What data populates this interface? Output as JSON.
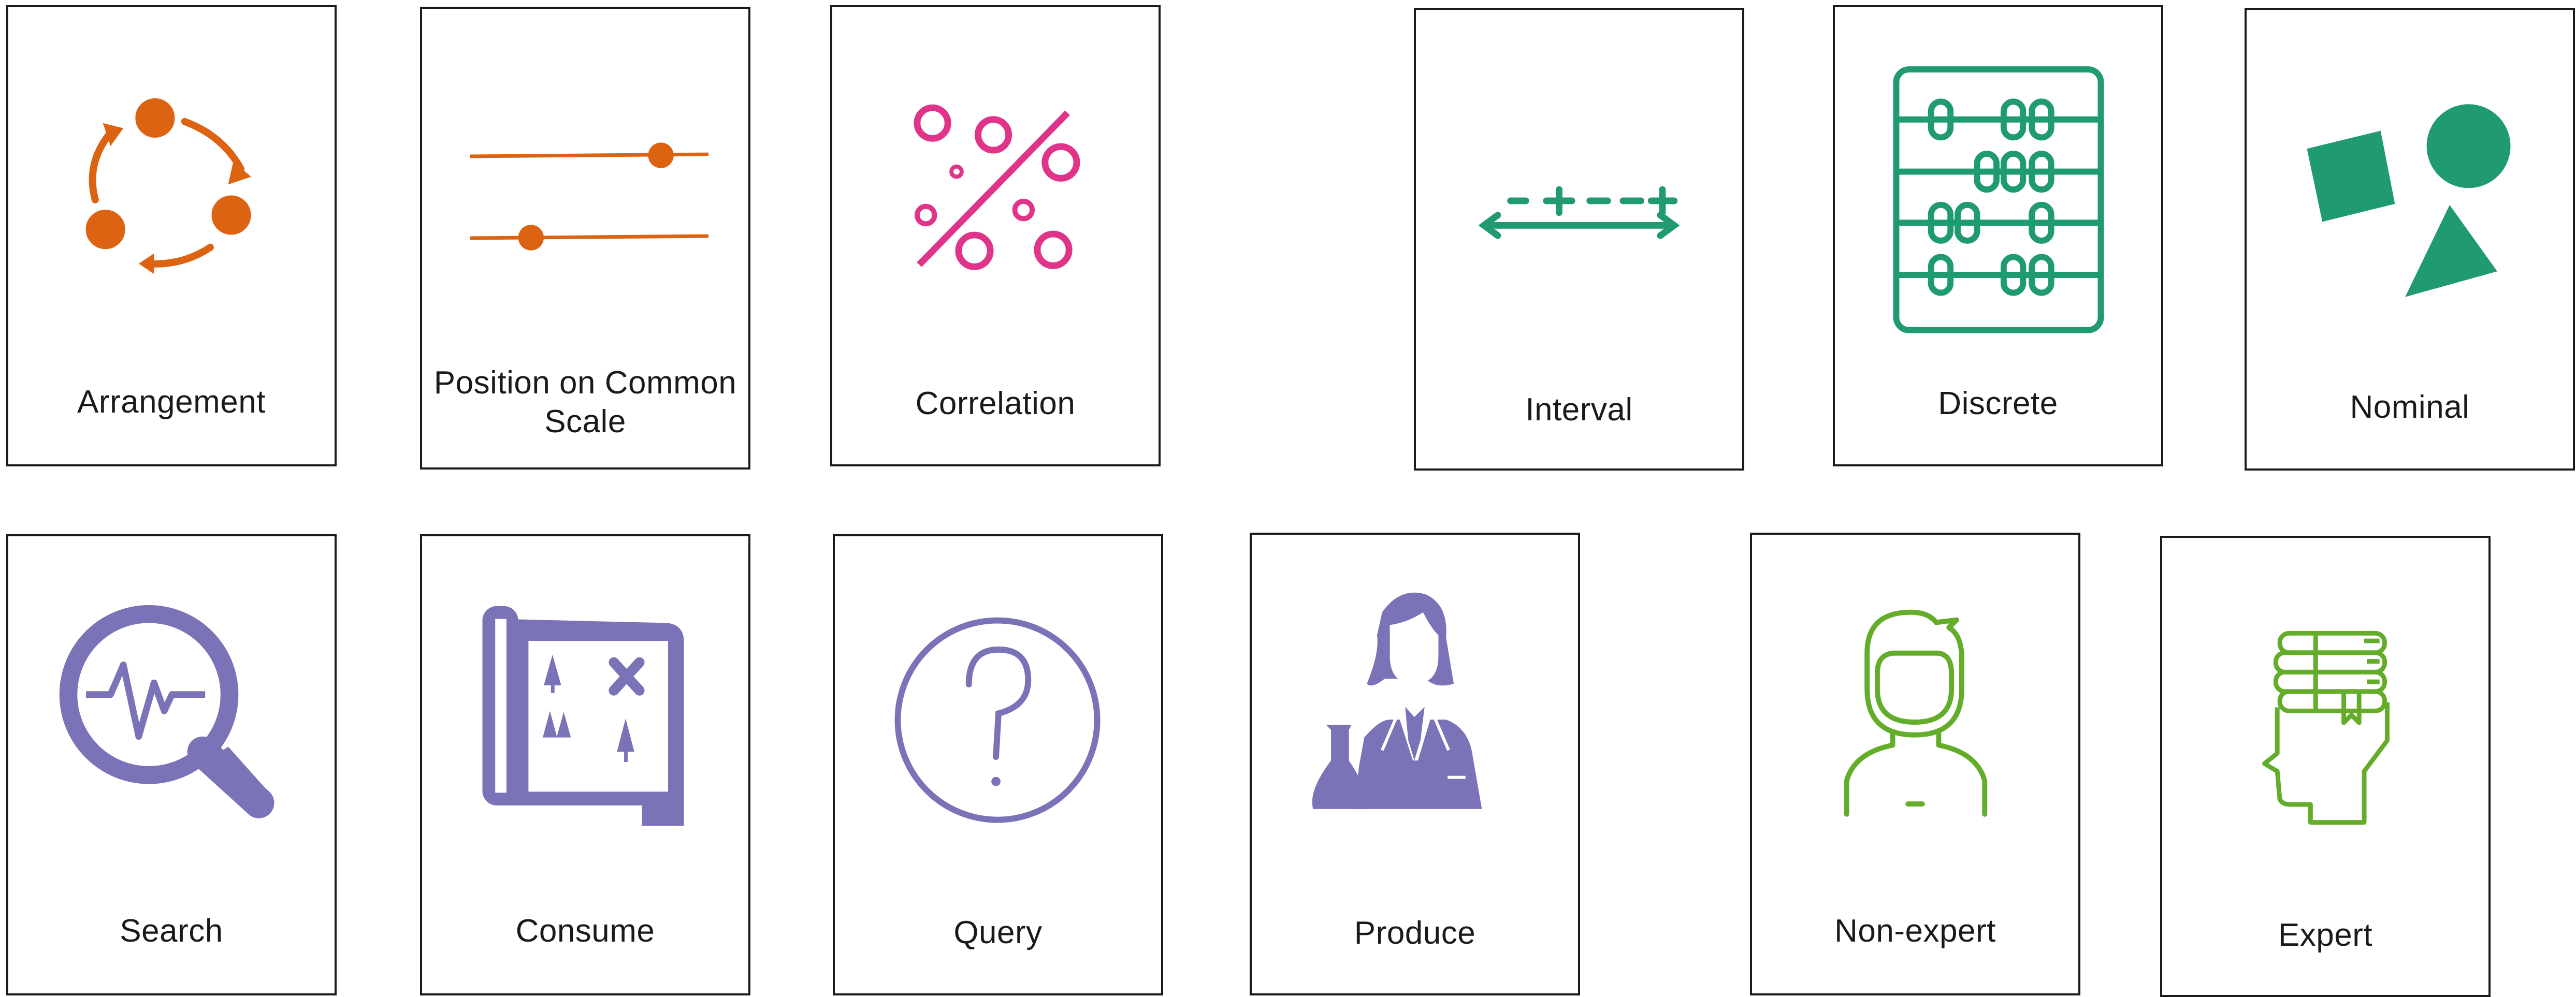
{
  "cards": [
    {
      "label": "Arrangement",
      "icon": "cycle-arrows-icon"
    },
    {
      "label": "Position on Common Scale",
      "icon": "slider-scale-icon"
    },
    {
      "label": "Correlation",
      "icon": "percent-scatter-icon"
    },
    {
      "label": "Interval",
      "icon": "interval-line-icon"
    },
    {
      "label": "Discrete",
      "icon": "abacus-icon"
    },
    {
      "label": "Nominal",
      "icon": "shapes-icon"
    },
    {
      "label": "Search",
      "icon": "magnifier-pulse-icon"
    },
    {
      "label": "Consume",
      "icon": "map-scroll-icon"
    },
    {
      "label": "Query",
      "icon": "question-circle-icon"
    },
    {
      "label": "Produce",
      "icon": "scientist-icon"
    },
    {
      "label": "Non-expert",
      "icon": "person-outline-icon"
    },
    {
      "label": "Expert",
      "icon": "head-books-icon"
    }
  ],
  "colors": {
    "orange": "#dc6311",
    "pink": "#e0348a",
    "teal": "#1f9a72",
    "purple": "#7a73b8",
    "green": "#63ad2a"
  }
}
